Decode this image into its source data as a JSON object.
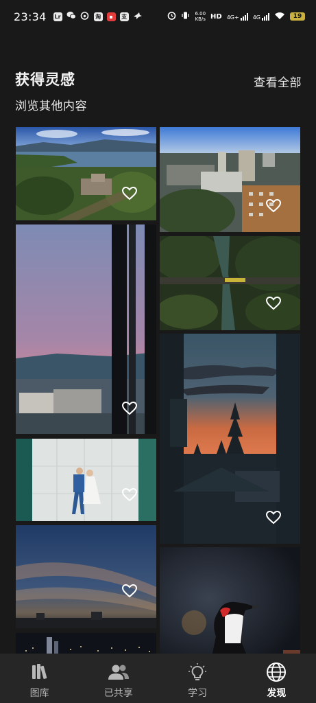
{
  "status_bar": {
    "time": "23:34",
    "app_badges": [
      "Lr",
      "淘",
      "支"
    ],
    "net_speed_value": "6.00",
    "net_speed_unit": "KB/s",
    "hd_label": "HD",
    "signal_1": "4G+",
    "signal_2": "4G",
    "battery": "19",
    "colors": {
      "battery": "#c9b040"
    }
  },
  "header": {
    "title": "获得灵感",
    "subtitle": "浏览其他内容",
    "view_all": "查看全部"
  },
  "photos": [
    {
      "name": "photo-lake-estate",
      "like_icon": "heart-outline-icon"
    },
    {
      "name": "photo-city-aerial",
      "like_icon": "heart-outline-icon"
    },
    {
      "name": "photo-window-dusk",
      "like_icon": "heart-outline-icon"
    },
    {
      "name": "photo-river-bridge",
      "like_icon": "heart-outline-icon"
    },
    {
      "name": "photo-sunset-pines",
      "like_icon": "heart-outline-icon"
    },
    {
      "name": "photo-wedding-couple",
      "like_icon": "heart-outline-icon"
    },
    {
      "name": "photo-evening-sky",
      "like_icon": "heart-outline-icon"
    },
    {
      "name": "photo-woodpecker",
      "like_icon": "heart-outline-icon"
    },
    {
      "name": "photo-night-city",
      "like_icon": "heart-outline-icon"
    }
  ],
  "tabs": [
    {
      "label": "图库",
      "icon": "library-books-icon",
      "active": false
    },
    {
      "label": "已共享",
      "icon": "shared-people-icon",
      "active": false
    },
    {
      "label": "学习",
      "icon": "lightbulb-icon",
      "active": false
    },
    {
      "label": "发现",
      "icon": "globe-icon",
      "active": true
    }
  ],
  "colors": {
    "background": "#191919",
    "tab_bar": "#262626",
    "active_tab": "#ffffff",
    "inactive_tab": "#b8b8b8"
  }
}
